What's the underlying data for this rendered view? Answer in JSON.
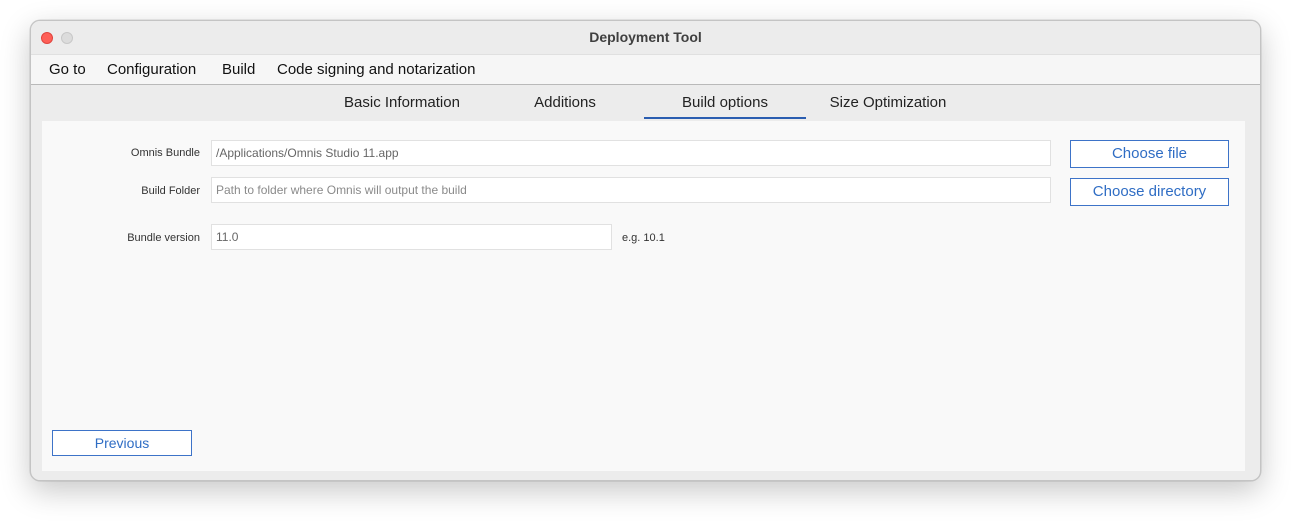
{
  "window": {
    "title": "Deployment Tool"
  },
  "menu": {
    "items": [
      {
        "label": "Go to"
      },
      {
        "label": "Configuration"
      },
      {
        "label": "Build"
      },
      {
        "label": "Code signing and notarization"
      }
    ]
  },
  "tabs": {
    "items": [
      {
        "label": "Basic Information"
      },
      {
        "label": "Additions"
      },
      {
        "label": "Build options"
      },
      {
        "label": "Size Optimization"
      }
    ],
    "selected": "Build options"
  },
  "form": {
    "omnis_bundle": {
      "label": "Omnis Bundle",
      "value": "/Applications/Omnis Studio 11.app",
      "button": "Choose file"
    },
    "build_folder": {
      "label": "Build Folder",
      "placeholder": "Path to folder where Omnis will output the build",
      "button": "Choose directory"
    },
    "bundle_version": {
      "label": "Bundle version",
      "value": "11.0",
      "hint": "e.g. 10.1"
    }
  },
  "navigation": {
    "previous_label": "Previous"
  },
  "colors": {
    "accent": "#2f6dc4",
    "tab_underline": "#2a5db0",
    "close_button": "#fe5f57"
  }
}
